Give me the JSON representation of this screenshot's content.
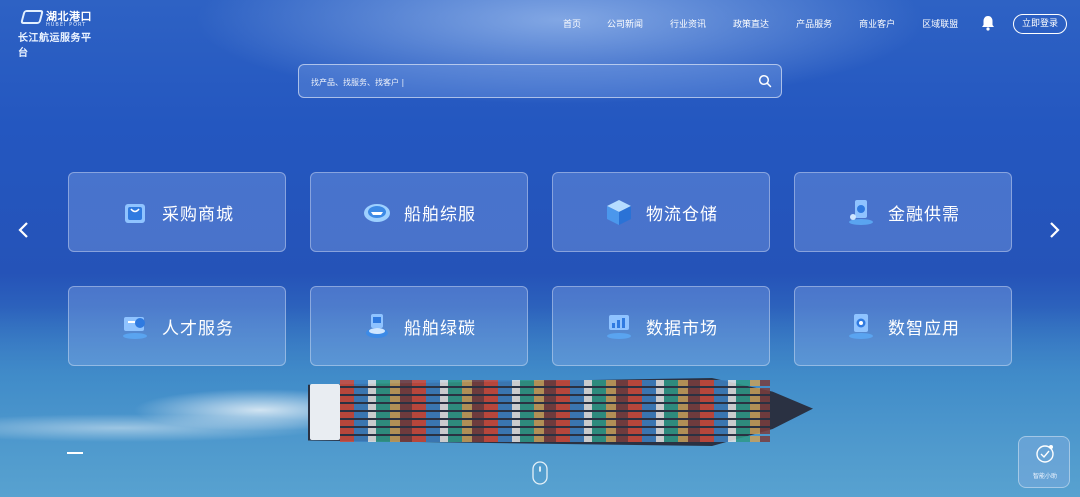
{
  "brand": {
    "logo_top": "湖北港口",
    "logo_en": "HUBEI PORT",
    "logo_bottom": "长江航运服务平台"
  },
  "nav": {
    "items": [
      {
        "label": "首页"
      },
      {
        "label": "公司新闻"
      },
      {
        "label": "行业资讯"
      },
      {
        "label": "政策直达"
      },
      {
        "label": "产品服务"
      },
      {
        "label": "商业客户"
      },
      {
        "label": "区域联盟"
      }
    ],
    "login_label": "立即登录",
    "icons": {
      "notification": "bell-icon"
    }
  },
  "search": {
    "placeholder": "找产品、找服务、找客户 |",
    "value": "",
    "icon": "search-icon"
  },
  "services": {
    "row1": [
      {
        "label": "采购商城",
        "icon": "shopping-bag-icon"
      },
      {
        "label": "船舶综服",
        "icon": "ship-service-icon"
      },
      {
        "label": "物流仓储",
        "icon": "warehouse-box-icon"
      },
      {
        "label": "金融供需",
        "icon": "finance-icon"
      }
    ],
    "row2": [
      {
        "label": "人才服务",
        "icon": "talent-icon"
      },
      {
        "label": "船舶绿碳",
        "icon": "green-carbon-icon"
      },
      {
        "label": "数据市场",
        "icon": "data-market-icon"
      },
      {
        "label": "数智应用",
        "icon": "smart-app-icon"
      }
    ]
  },
  "carousel": {
    "prev_icon": "chevron-left-icon",
    "next_icon": "chevron-right-icon"
  },
  "float_widget": {
    "label": "智能小助",
    "icon": "assistant-icon"
  },
  "colors": {
    "primary_bg": "#2553b8",
    "card_bg": "rgba(150,180,240,0.32)",
    "text": "#ffffff"
  }
}
